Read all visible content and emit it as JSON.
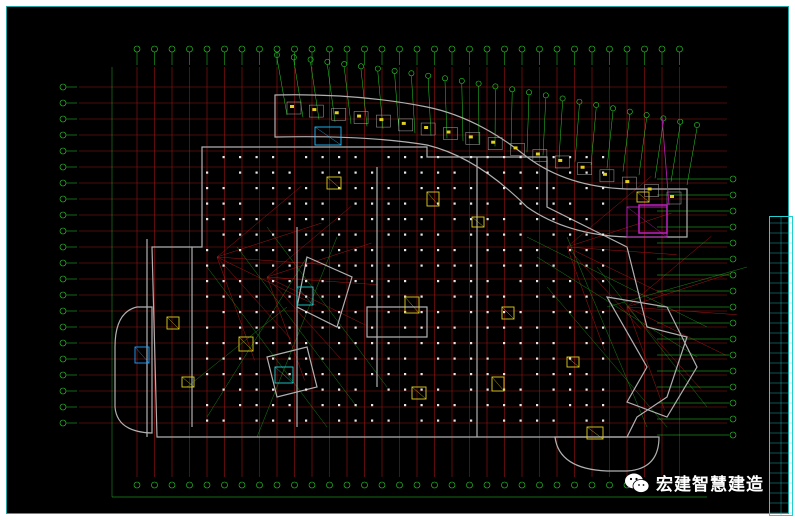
{
  "watermark": {
    "text": "宏建智慧建造",
    "icon": "wechat-icon"
  },
  "drawing": {
    "type": "architectural floor plan (CAD, black background)",
    "colors": {
      "background": "#000000",
      "axis_lines": "#c41a1a",
      "axis_bubbles": "#28d428",
      "walls": "#b8b8b8",
      "columns": "#ffffff",
      "highlight": "#c020c0",
      "frame": "#1fa5a5",
      "annotations": "#e0d020"
    }
  }
}
